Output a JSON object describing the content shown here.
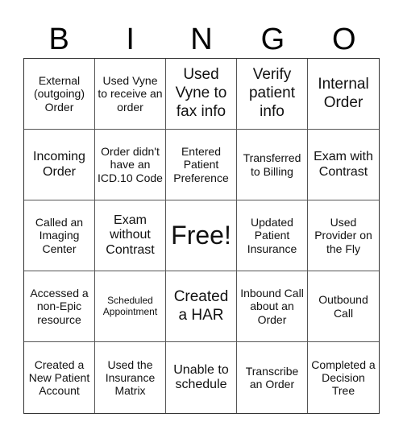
{
  "header": {
    "letters": [
      "B",
      "I",
      "N",
      "G",
      "O"
    ]
  },
  "board": {
    "rows": [
      [
        "External (outgoing) Order",
        "Used Vyne to receive an order",
        "Used Vyne to fax info",
        "Verify patient info",
        "Internal Order"
      ],
      [
        "Incoming Order",
        "Order didn't have an ICD.10 Code",
        "Entered Patient Preference",
        "Transferred to Billing",
        "Exam with Contrast"
      ],
      [
        "Called an Imaging Center",
        "Exam without Contrast",
        "Free!",
        "Updated Patient Insurance",
        "Used Provider on the Fly"
      ],
      [
        "Accessed a non-Epic resource",
        "Scheduled Appointment",
        "Created a HAR",
        "Inbound Call about an Order",
        "Outbound Call"
      ],
      [
        "Created a New Patient Account",
        "Used the Insurance Matrix",
        "Unable to schedule",
        "Transcribe an Order",
        "Completed a Decision Tree"
      ]
    ],
    "free_space": "Free!"
  }
}
